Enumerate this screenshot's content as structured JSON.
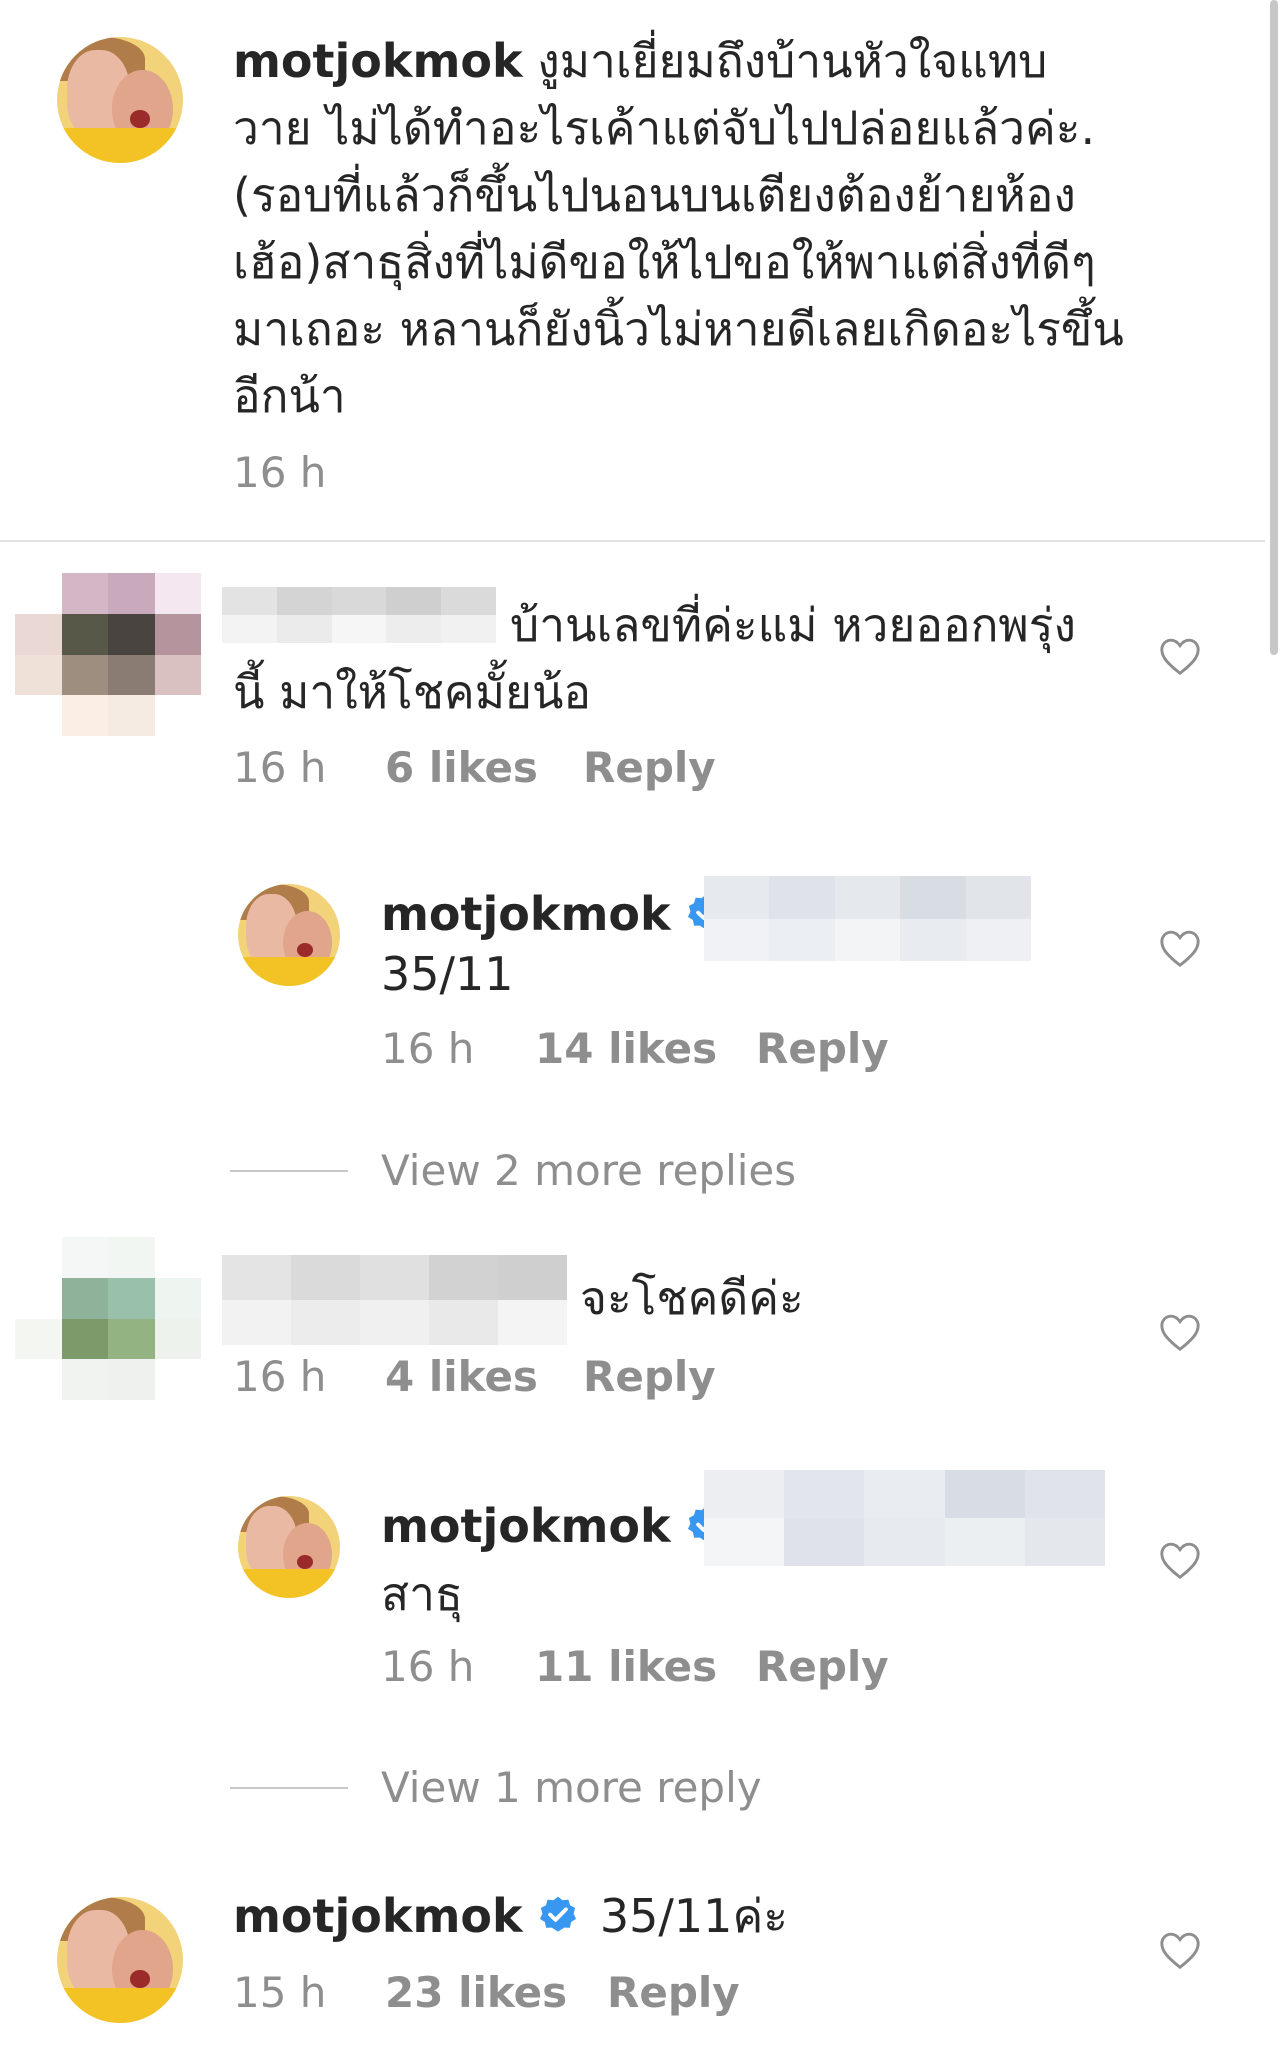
{
  "caption": {
    "username": "motjokmok",
    "lines": [
      "งูมาเยี่ยมถึงบ้านหัวใจแทบ",
      "วาย  ไม่ได้ทำอะไรเค้าแต่จับไปปล่อยแล้วค่ะ.",
      "(รอบที่แล้วก็ขึ้นไปนอนบนเตียงต้องย้ายห้อง",
      "เฮ้อ)สาธุสิ่งที่ไม่ดีขอให้ไปขอให้พาแต่สิ่งที่ดีๆ",
      "มาเถอะ หลานก็ยังนิ้วไม่หายดีเลยเกิดอะไรขึ้น",
      "อีกน้า"
    ],
    "time": "16 h"
  },
  "comments": [
    {
      "text_line1": "บ้านเลขที่ค่ะแม่ หวยออกพรุ่ง",
      "text_line2": "นี้ มาให้โชคมั้ยน้อ",
      "time": "16 h",
      "likes": "6 likes",
      "reply": "Reply"
    },
    {
      "username": "motjokmok",
      "text": "35/11",
      "time": "16 h",
      "likes": "14 likes",
      "reply": "Reply"
    },
    {
      "view_more": "View 2 more replies"
    },
    {
      "text": "จะโชคดีค่ะ",
      "time": "16 h",
      "likes": "4 likes",
      "reply": "Reply"
    },
    {
      "username": "motjokmok",
      "text": "สาธุ",
      "time": "16 h",
      "likes": "11 likes",
      "reply": "Reply"
    },
    {
      "view_more": "View 1 more reply"
    },
    {
      "username": "motjokmok",
      "text": "35/11ค่ะ",
      "time": "15 h",
      "likes": "23 likes",
      "reply": "Reply"
    }
  ],
  "colors": {
    "verified": "#3897f0",
    "meta": "#8e8e8e",
    "text": "#262626"
  }
}
